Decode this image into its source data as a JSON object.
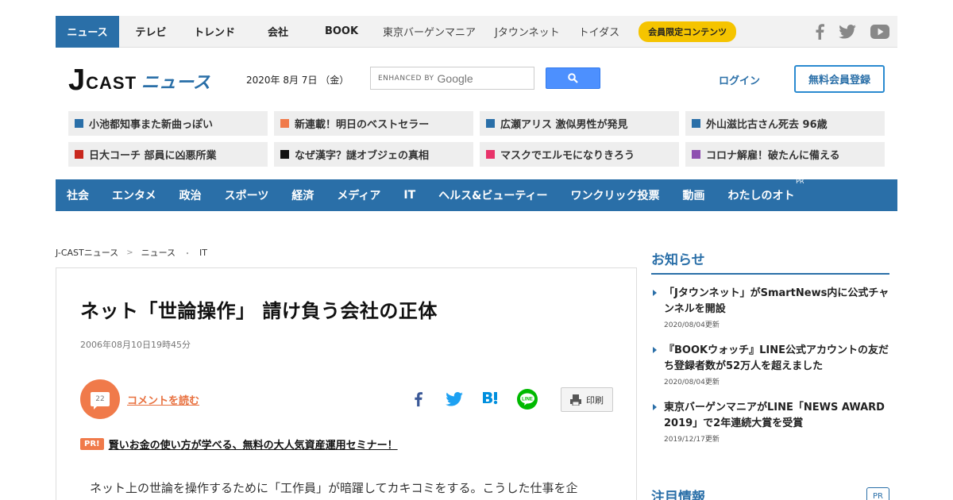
{
  "topnav": {
    "items": [
      {
        "label": "ニュース"
      },
      {
        "label": "テレビ"
      },
      {
        "label": "トレンド"
      },
      {
        "label": "会社"
      },
      {
        "label": "BOOK"
      },
      {
        "label": "東京バーゲンマニア"
      },
      {
        "label": "Jタウンネット"
      },
      {
        "label": "トイダス"
      }
    ],
    "member_label": "会員限定コンテンツ",
    "social_icons": [
      "facebook-icon",
      "twitter-icon",
      "youtube-icon"
    ]
  },
  "header": {
    "logo_j": "J",
    "logo_cast": "CAST",
    "logo_news": "ニュース",
    "date": "2020年 8月 7日 （金）",
    "search_enhanced": "ENHANCED BY",
    "search_google": "Google",
    "login_label": "ログイン",
    "register_label": "無料会員登録"
  },
  "chips": [
    {
      "label": "小池都知事また新曲っぽい",
      "color": "#2a6fa8"
    },
    {
      "label": "新連載！明日のベストセラー",
      "color": "#f07a4a"
    },
    {
      "label": "広瀬アリス 激似男性が発見",
      "color": "#2a6fa8"
    },
    {
      "label": "外山滋比古さん死去 96歳",
      "color": "#2a6fa8"
    },
    {
      "label": "日大コーチ 部員に凶悪所業",
      "color": "#c8281e"
    },
    {
      "label": "なぜ漢字？謎オブジェの真相",
      "color": "#111111"
    },
    {
      "label": "マスクでエルモになりきろう",
      "color": "#e8336a"
    },
    {
      "label": "コロナ解雇！破たんに備える",
      "color": "#8e4fb0"
    }
  ],
  "categories": [
    {
      "label": "社会"
    },
    {
      "label": "エンタメ"
    },
    {
      "label": "政治"
    },
    {
      "label": "スポーツ"
    },
    {
      "label": "経済"
    },
    {
      "label": "メディア"
    },
    {
      "label": "IT"
    },
    {
      "label": "ヘルス&ビューティー"
    },
    {
      "label": "ワンクリック投票"
    },
    {
      "label": "動画"
    },
    {
      "label": "わたしのオト",
      "badge": "PR"
    }
  ],
  "breadcrumb": [
    "J-CASTニュース",
    "ニュース",
    "IT"
  ],
  "article": {
    "title": "ネット「世論操作」 請け負う会社の正体",
    "timestamp": "2006年08月10日19時45分",
    "comment_count": "22",
    "comment_link": "コメントを読む",
    "print_label": "印刷",
    "pr_badge": "PR!",
    "pr_text": "賢いお金の使い方が学べる、無料の大人気資産運用セミナー！",
    "body": "ネット上の世論を操作するために「工作員」が暗躍してカキコミをする。こうした仕事を企"
  },
  "sidebar": {
    "heading": "お知らせ",
    "notices": [
      {
        "title": "「Jタウンネット」がSmartNews内に公式チャンネルを開設",
        "date": "2020/08/04更新"
      },
      {
        "title": "『BOOKウォッチ』LINE公式アカウントの友だち登録者数が52万人を超えました",
        "date": "2020/08/04更新"
      },
      {
        "title": "東京バーゲンマニアがLINE「NEWS AWARD 2019」で2年連続大賞を受賞",
        "date": "2019/12/17更新"
      }
    ],
    "heading2": "注目情報",
    "pr_label": "PR"
  }
}
